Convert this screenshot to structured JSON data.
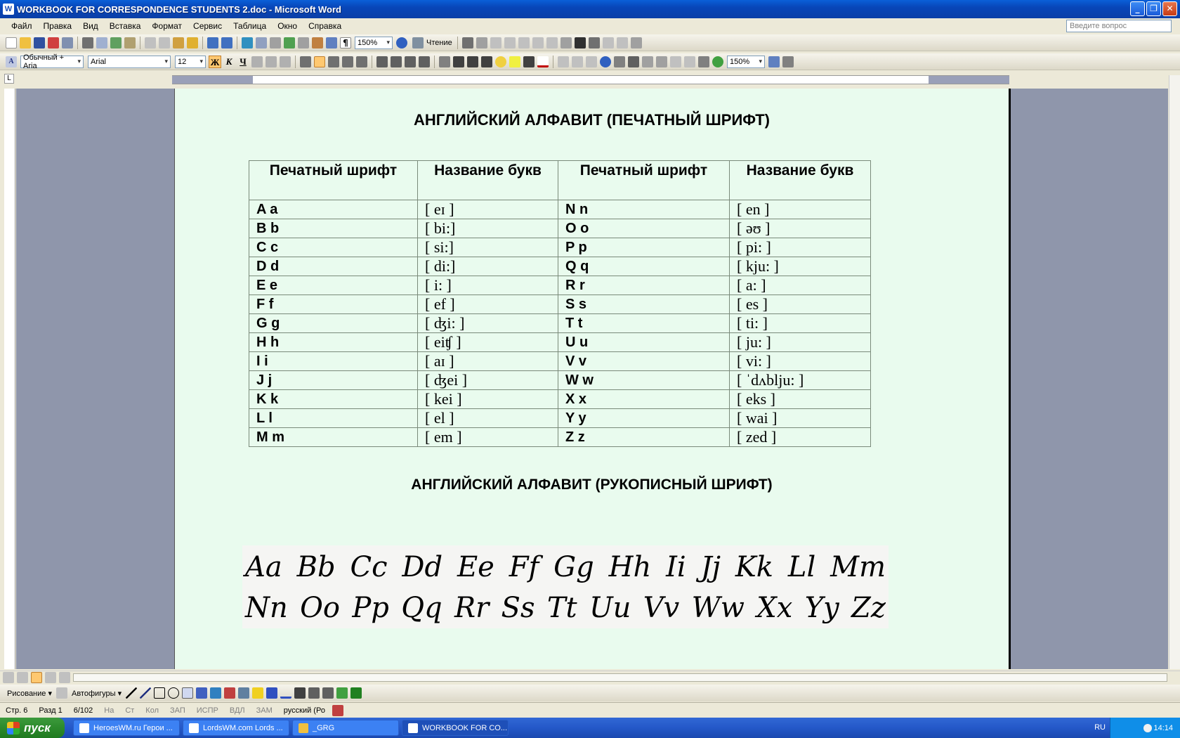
{
  "window": {
    "title": "WORKBOOK FOR CORRESPONDENCE STUDENTS 2.doc - Microsoft Word"
  },
  "menu": [
    "Файл",
    "Правка",
    "Вид",
    "Вставка",
    "Формат",
    "Сервис",
    "Таблица",
    "Окно",
    "Справка"
  ],
  "ask_placeholder": "Введите вопрос",
  "toolbar": {
    "zoom1": "150%",
    "reading": "Чтение",
    "zoom2": "150%"
  },
  "format": {
    "style": "Обычный + Aria",
    "font": "Arial",
    "size": "12",
    "bold": "Ж",
    "italic": "К",
    "underline": "Ч"
  },
  "document": {
    "title1": "АНГЛИЙСКИЙ АЛФАВИТ (ПЕЧАТНЫЙ ШРИФТ)",
    "headers": [
      "Печатный шрифт",
      "Название букв",
      "Печатный шрифт",
      "Название  букв"
    ],
    "rows": [
      [
        "A  a",
        "[ eɪ ]",
        "N  n",
        "[ en ]"
      ],
      [
        "B b",
        "[ bi:]",
        "O o",
        "[ əʊ ]"
      ],
      [
        "C c",
        "[ si:]",
        "P p",
        "[ pi: ]"
      ],
      [
        "D d",
        "[ di:]",
        "Q q",
        "[ kju: ]"
      ],
      [
        "E e",
        "[ i: ]",
        "R r",
        "[ a: ]"
      ],
      [
        "F f",
        "[ ef ]",
        "S s",
        "[ es ]"
      ],
      [
        "G g",
        "[ ʤi: ]",
        "T t",
        "[ ti: ]"
      ],
      [
        "H h",
        "[ eiʧ ]",
        "U u",
        "[ ju: ]"
      ],
      [
        "I i",
        "[ aɪ ]",
        "V v",
        "[ vi: ]"
      ],
      [
        "J j",
        "[ ʤei ]",
        "W w",
        "[ ˈdʌblju: ]"
      ],
      [
        "K k",
        "[ kei ]",
        "X x",
        "[ eks ]"
      ],
      [
        "L l",
        "[ el ]",
        "Y y",
        "[ wai ]"
      ],
      [
        "M m",
        "[ em ]",
        "Z z",
        "[ zed ]"
      ]
    ],
    "title2": "АНГЛИЙСКИЙ АЛФАВИТ (РУКОПИСНЫЙ ШРИФТ)",
    "cursive_row1": [
      "Aa",
      "Bb",
      "Cc",
      "Dd",
      "Ee",
      "Ff",
      "Gg",
      "Hh",
      "Ii",
      "Jj",
      "Kk",
      "Ll",
      "Mm"
    ],
    "cursive_row2": [
      "Nn",
      "Oo",
      "Pp",
      "Qq",
      "Rr",
      "Ss",
      "Tt",
      "Uu",
      "Vv",
      "Ww",
      "Xx",
      "Yy",
      "Zz"
    ]
  },
  "drawbar": {
    "drawing": "Рисование ▾",
    "autoshapes": "Автофигуры ▾"
  },
  "status": {
    "page": "Стр. 6",
    "section": "Разд 1",
    "pages": "6/102",
    "at": "На",
    "line": "Ст",
    "col": "Кол",
    "rec": "ЗАП",
    "trk": "ИСПР",
    "ext": "ВДЛ",
    "ovr": "ЗАМ",
    "language": "русский (Ро"
  },
  "taskbar": {
    "start": "пуск",
    "tasks": [
      "HeroesWM.ru Герои ...",
      "LordsWM.com Lords ...",
      "_GRG",
      "WORKBOOK FOR CO..."
    ],
    "lang": "RU",
    "clock": "14:14"
  }
}
